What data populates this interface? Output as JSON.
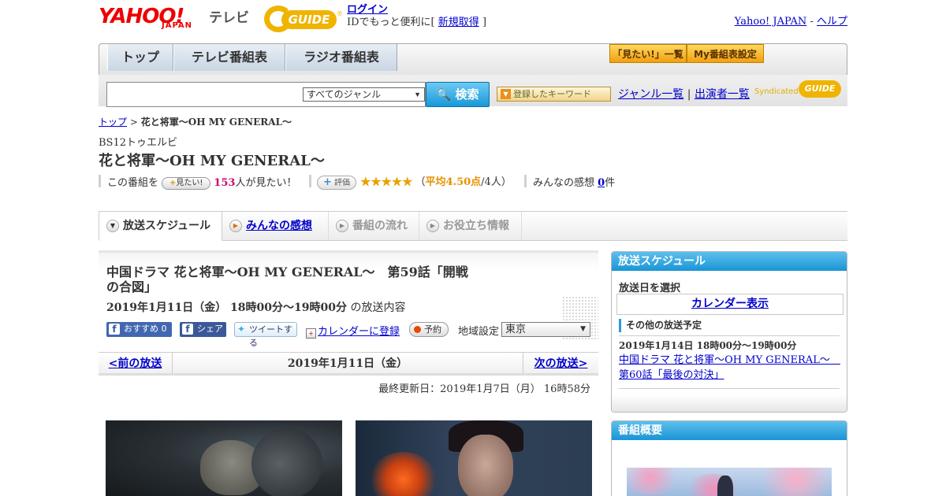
{
  "header": {
    "logo_yahoo": "YAHOO!",
    "logo_japan": "JAPAN",
    "logo_tv": "テレビ",
    "gguide_logo": "GUIDE",
    "login": "ログイン",
    "login_desc": "IDでもっと便利に[",
    "register": "新規取得",
    "register_close": "]",
    "yahoo_japan_link": "Yahoo! JAPAN",
    "sep": "-",
    "help_link": "ヘルプ"
  },
  "nav": {
    "tabs": [
      "トップ",
      "テレビ番組表",
      "ラジオ番組表"
    ],
    "want_list": "「見たい!」一覧",
    "my_schedule": "My番組表設定"
  },
  "search": {
    "placeholder": "",
    "genre_selected": "すべてのジャンル",
    "search_button": "検索",
    "keyword_button": "登録したキーワード",
    "genre_list": "ジャンル一覧",
    "sep": "|",
    "cast_list": "出演者一覧",
    "syndicated": "Syndicated",
    "syndicated_logo": "GUIDE"
  },
  "breadcrumb": {
    "top": "トップ",
    "sep": ">",
    "current": "花と将軍～OH MY GENERAL～"
  },
  "program": {
    "channel": "BS12トゥエルビ",
    "title": "花と将軍～OH MY GENERAL～",
    "want_prefix": "この番組を",
    "want_button": "見たい!",
    "want_count": "153",
    "want_suffix": "人が見たい！",
    "eval_button": "評価",
    "stars": "★★★★★",
    "rating_open": "（",
    "rating_avg": "平均4.50点",
    "rating_count": "/4人）",
    "impressions_label": "みんなの感想",
    "impressions_count": "0",
    "impressions_suffix": "件"
  },
  "tabs": [
    "放送スケジュール",
    "みんなの感想",
    "番組の流れ",
    "お役立ち情報"
  ],
  "episode": {
    "title": "中国ドラマ 花と将軍～OH MY GENERAL～　第59話「開戦の合図」",
    "datetime": "2019年1月11日（金）  18時00分～19時00分",
    "datetime_suffix": " の放送内容",
    "fb_recommend": "おすすめ 0",
    "fb_share": "シェア",
    "tweet": "ツイートする",
    "calendar_register": "カレンダーに登録",
    "reserve": "予約",
    "region_label": "地域設定",
    "region_value": "東京"
  },
  "pager": {
    "prev": "<前の放送",
    "date": "2019年1月11日（金）",
    "next": "次の放送>"
  },
  "updated": "最終更新日：2019年1月7日（月）  16時58分",
  "sidebar": {
    "schedule_title": "放送スケジュール",
    "select_date": "放送日を選択",
    "calendar_button": "カレンダー表示",
    "other_schedule": "その他の放送予定",
    "next_time": "2019年1月14日  18時00分～19時00分",
    "next_link": "中国ドラマ 花と将軍～OH MY GENERAL～　第60話「最後の対決」",
    "overview_title": "番組概要"
  },
  "colors": {
    "accent_blue": "#1a94d4",
    "link": "#0000cc",
    "star": "#e8a200",
    "want_count": "#d0006a"
  }
}
